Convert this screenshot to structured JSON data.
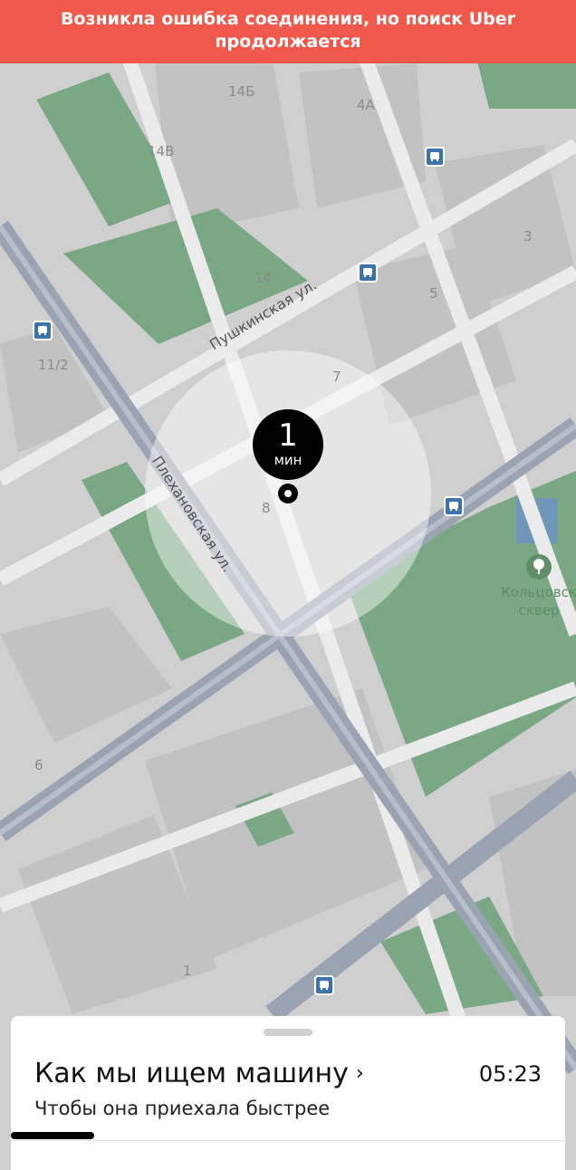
{
  "banner": {
    "text": "Возникла ошибка соединения, но поиск Uber продолжается"
  },
  "map": {
    "building_numbers": [
      "14Б",
      "4А",
      "14В",
      "3",
      "14",
      "5",
      "11/2",
      "7",
      "8",
      "6",
      "1"
    ],
    "streets": [
      "Пушкинская ул.",
      "Плехановская ул."
    ],
    "park_name_line1": "Кольцовск",
    "park_name_line2": "сквер",
    "icons": {
      "transit_stop": "bus-stop-icon",
      "park": "tree-icon"
    }
  },
  "eta": {
    "value": "1",
    "unit": "мин"
  },
  "sheet": {
    "title": "Как мы ищем машину",
    "chevron": "›",
    "subtitle": "Чтобы она приехала быстрее",
    "timer": "05:23",
    "progress": 0.15
  },
  "colors": {
    "banner": "#f0584a",
    "map_background": "#cfcfcf",
    "park": "#7aa884",
    "road": "#9aa3b2",
    "pickup_circle": "rgba(255,255,255,0.45)",
    "progress": "#000000"
  }
}
